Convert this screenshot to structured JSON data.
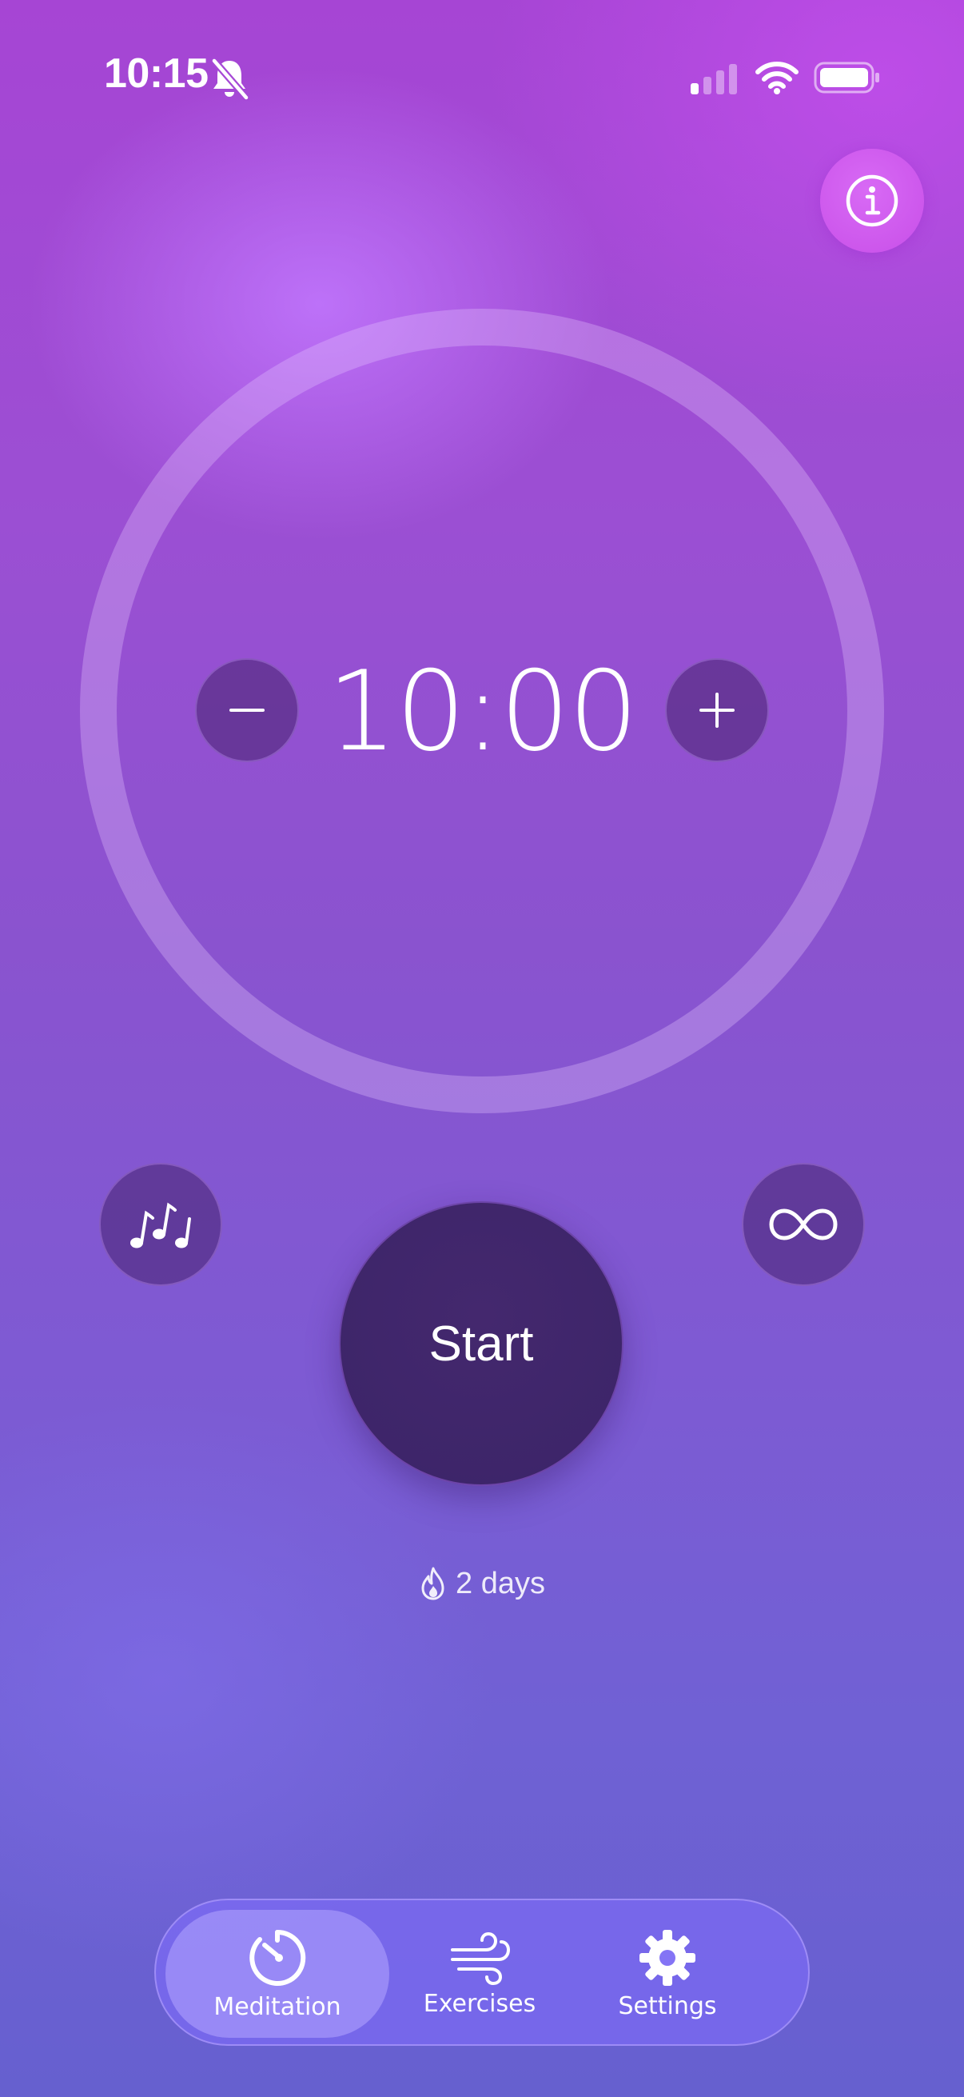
{
  "status_bar": {
    "time": "10:15",
    "silent_icon": "bell-slash-icon",
    "signal_icon": "cellular-signal-icon",
    "wifi_icon": "wifi-icon",
    "battery_icon": "battery-icon"
  },
  "header": {
    "info_icon": "info-icon"
  },
  "timer": {
    "value": "10:00",
    "decrease_icon": "minus-icon",
    "increase_icon": "plus-icon"
  },
  "controls": {
    "music_icon": "music-notes-icon",
    "loop_icon": "infinity-icon",
    "start_label": "Start"
  },
  "streak": {
    "icon": "flame-icon",
    "label": "2 days"
  },
  "tabs": [
    {
      "label": "Meditation",
      "icon": "timer-icon",
      "selected": true
    },
    {
      "label": "Exercises",
      "icon": "wind-icon",
      "selected": false
    },
    {
      "label": "Settings",
      "icon": "gear-icon",
      "selected": false
    }
  ],
  "colors": {
    "background_top": "#a645d4",
    "background_bottom": "#6660cf",
    "start_button": "#3f2669",
    "info_button": "#d05cef",
    "tab_bar": "#826eff"
  }
}
